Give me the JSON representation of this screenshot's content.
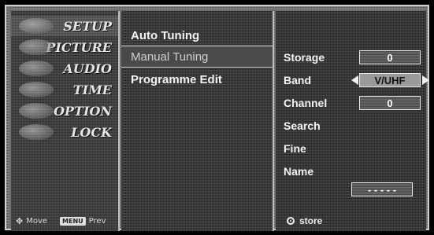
{
  "menu": [
    {
      "label": "SETUP",
      "icon": "setup-icon",
      "active": true
    },
    {
      "label": "PICTURE",
      "icon": "picture-icon"
    },
    {
      "label": "AUDIO",
      "icon": "audio-icon"
    },
    {
      "label": "TIME",
      "icon": "time-icon"
    },
    {
      "label": "OPTION",
      "icon": "option-icon"
    },
    {
      "label": "LOCK",
      "icon": "lock-icon"
    }
  ],
  "footer": {
    "move_label": "Move",
    "menu_key": "MENU",
    "prev_label": "Prev"
  },
  "submenu": [
    {
      "label": "Auto Tuning"
    },
    {
      "label": "Manual Tuning",
      "selected": true
    },
    {
      "label": "Programme Edit"
    }
  ],
  "settings": {
    "storage": {
      "label": "Storage",
      "value": "0"
    },
    "band": {
      "label": "Band",
      "value": "V/UHF"
    },
    "channel": {
      "label": "Channel",
      "value": "0"
    },
    "search": {
      "label": "Search"
    },
    "fine": {
      "label": "Fine"
    },
    "name": {
      "label": "Name",
      "value": "- - - - -"
    }
  },
  "store_label": "store",
  "colors": {
    "background": "#000000",
    "panel": "#707070",
    "text": "#f4f4f4",
    "highlight": "#9a9a9a"
  }
}
